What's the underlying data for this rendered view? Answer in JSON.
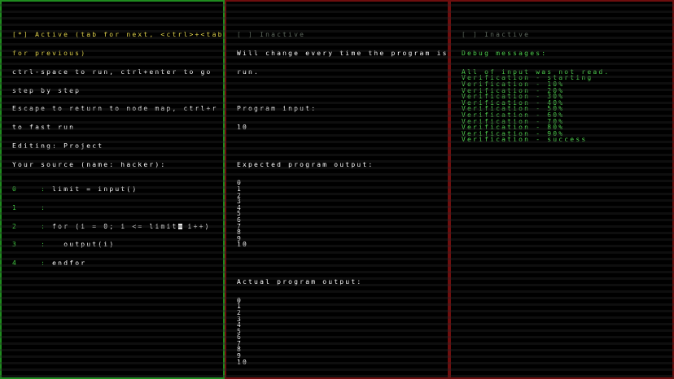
{
  "editor": {
    "status_line1": "[*] Active (tab for next, <ctrl>+<tab>",
    "status_line2": "for previous)",
    "help1": "ctrl-space to run, ctrl+enter to go",
    "help2": "step by step",
    "help3": "Escape to return to node map, ctrl+r",
    "help4": "to fast run",
    "editing": "Editing: Project",
    "source_header": "Your source (name: hacker):",
    "code_lines": [
      {
        "num": "0",
        "sep": ":",
        "text": " limit = input()"
      },
      {
        "num": "1",
        "sep": ":",
        "text": ""
      },
      {
        "num": "2",
        "sep": ":",
        "text_before": " for (i = 0; i <= limit",
        "text_after": " i++)"
      },
      {
        "num": "3",
        "sep": ":",
        "text": "   output(i)"
      },
      {
        "num": "4",
        "sep": ":",
        "text": " endfor"
      }
    ]
  },
  "io": {
    "status": "[ ] Inactive",
    "note1": "Will change every time the program is",
    "note2": "run.",
    "input_label": "Program input:",
    "input_value": "10",
    "expected_label": "Expected program output:",
    "expected": [
      "0",
      "1",
      "2",
      "3",
      "4",
      "5",
      "6",
      "7",
      "8",
      "9",
      "10"
    ],
    "actual_label": "Actual program output:",
    "actual": [
      "0",
      "1",
      "2",
      "3",
      "4",
      "5",
      "6",
      "7",
      "8",
      "9",
      "10"
    ]
  },
  "debug": {
    "status": "[ ] Inactive",
    "header": "Debug messages:",
    "messages": [
      "All of input was not read.",
      "Verification - starting",
      "Verification - 10%",
      "Verification - 20%",
      "Verification - 30%",
      "Verification - 40%",
      "Verification - 50%",
      "Verification - 60%",
      "Verification - 70%",
      "Verification - 80%",
      "Verification - 90%",
      "Verification - success"
    ]
  },
  "colors": {
    "active_border": "#1f8a1f",
    "inactive_border": "#6e0e0e",
    "active_status": "#e0d24a",
    "inactive_status": "#5f6a5f",
    "debug_text": "#4fd14f"
  }
}
